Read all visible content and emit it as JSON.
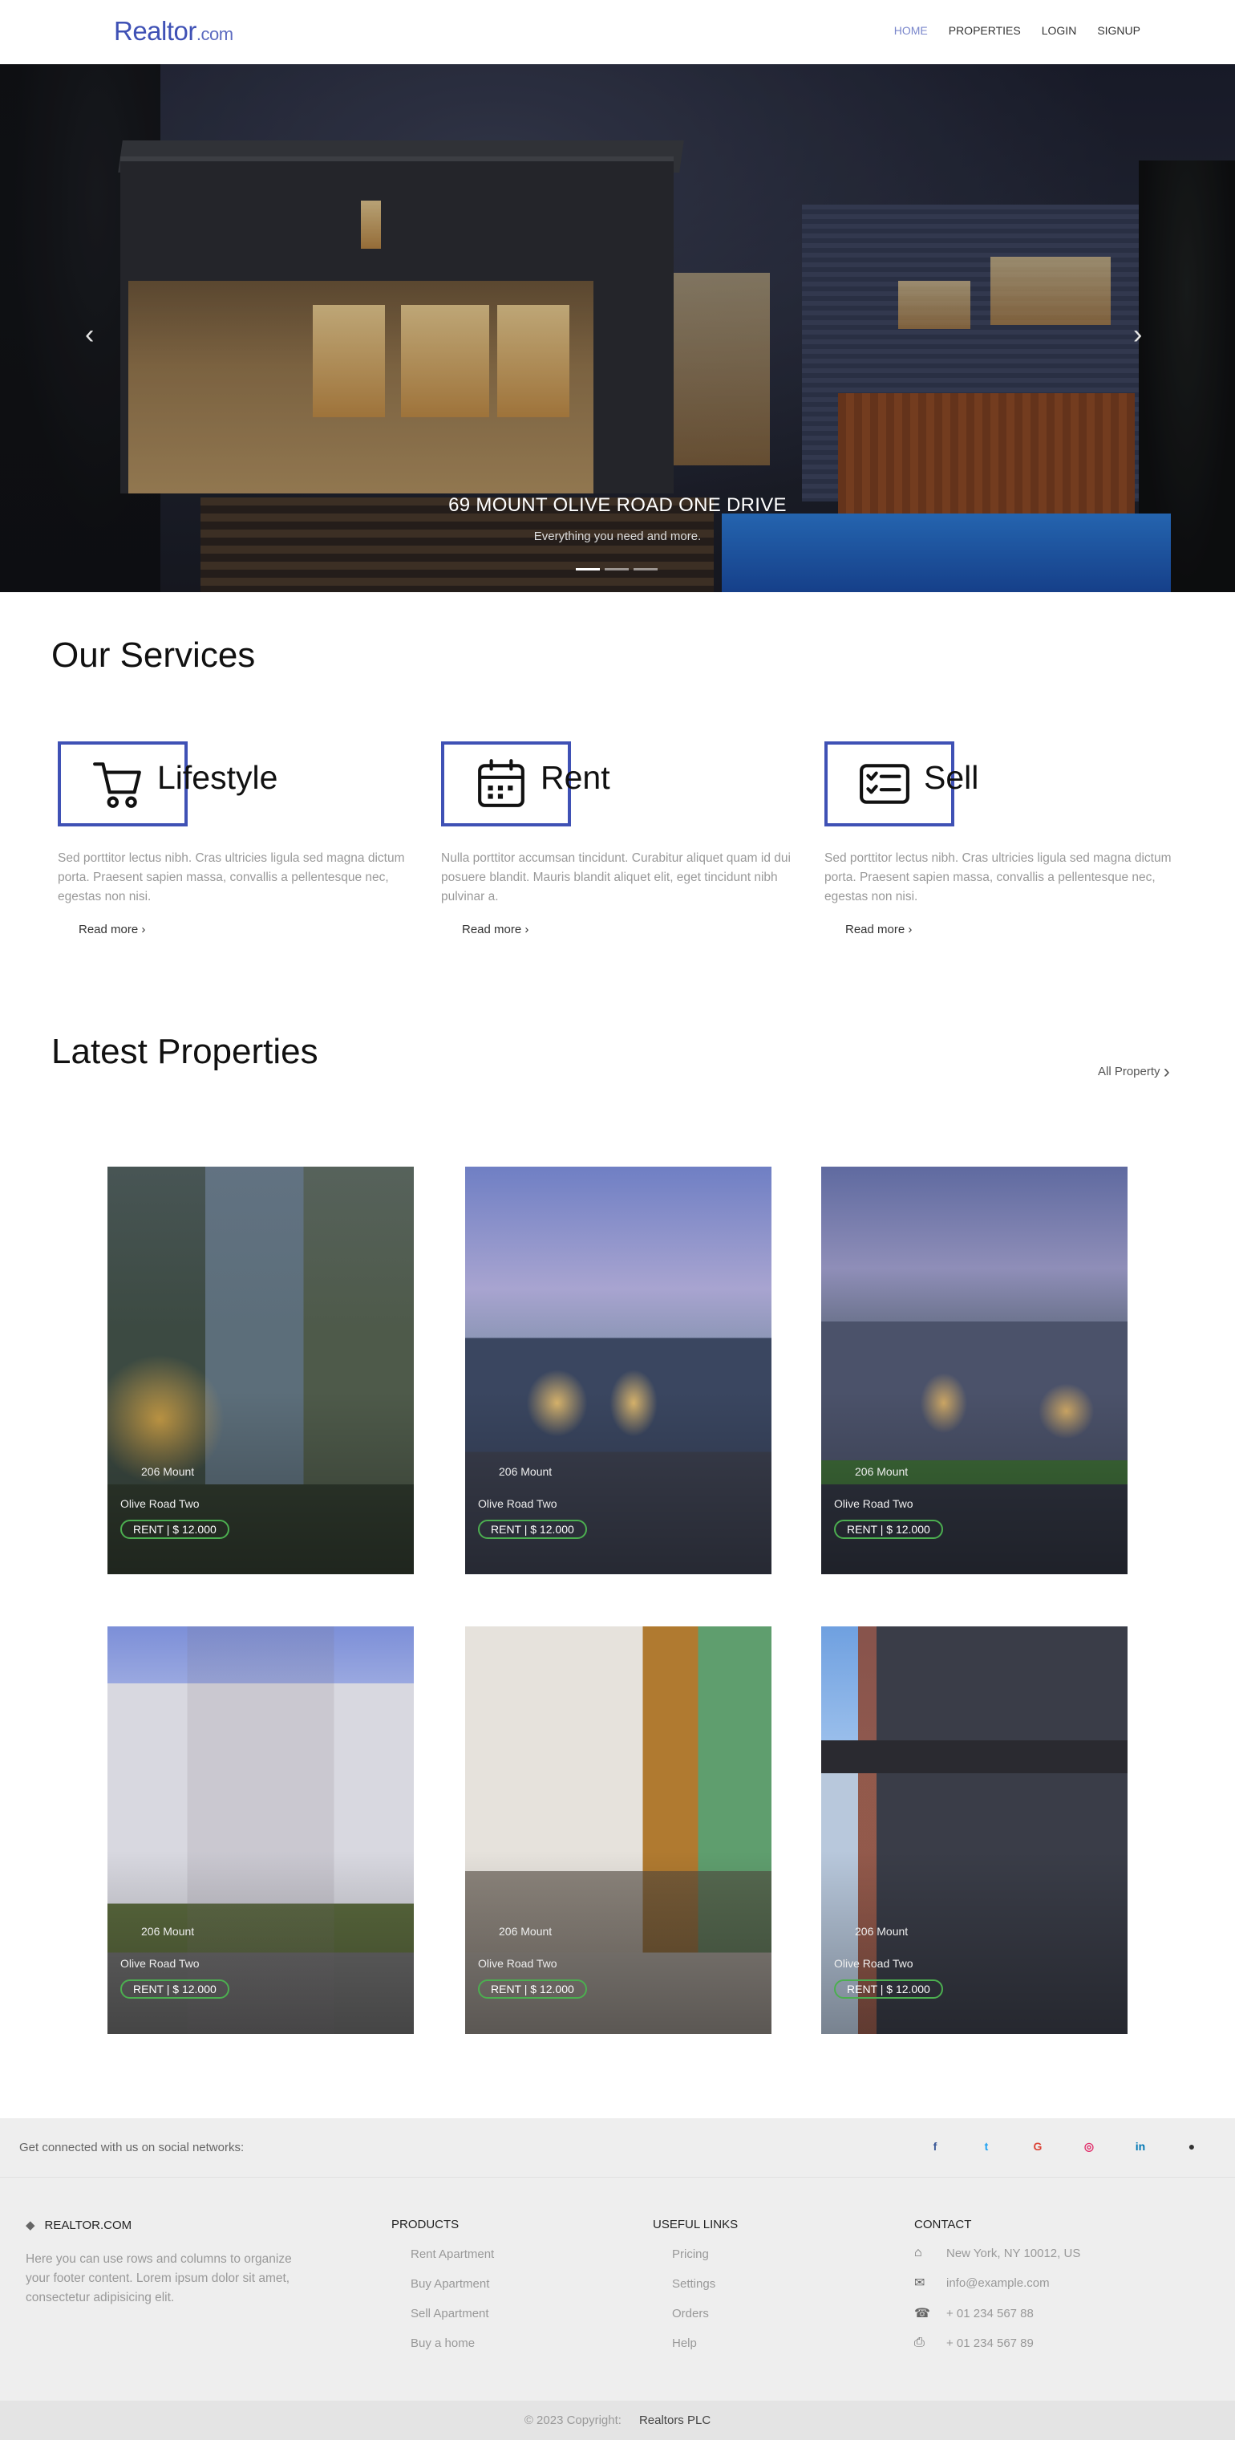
{
  "header": {
    "logo_main": "Realtor",
    "logo_tld": ".com",
    "nav": [
      "HOME",
      "PROPERTIES",
      "LOGIN",
      "SIGNUP"
    ]
  },
  "hero": {
    "title": "69 MOUNT OLIVE ROAD ONE DRIVE",
    "subtitle": "Everything you need and more.",
    "prev_icon": "chevron-left-icon",
    "next_icon": "chevron-right-icon",
    "slides": 3,
    "active_slide": 1
  },
  "services": {
    "title": "Our Services",
    "items": [
      {
        "name": "Lifestyle",
        "icon": "cart-icon",
        "desc": "Sed porttitor lectus nibh. Cras ultricies ligula sed magna dictum porta. Praesent sapien massa, convallis a pellentesque nec, egestas non nisi.",
        "more": "Read more"
      },
      {
        "name": "Rent",
        "icon": "calendar-icon",
        "desc": "Nulla porttitor accumsan tincidunt. Curabitur aliquet quam id dui posuere blandit. Mauris blandit aliquet elit, eget tincidunt nibh pulvinar a.",
        "more": "Read more"
      },
      {
        "name": "Sell",
        "icon": "checklist-icon",
        "desc": "Sed porttitor lectus nibh. Cras ultricies ligula sed magna dictum porta. Praesent sapien massa, convallis a pellentesque nec, egestas non nisi.",
        "more": "Read more"
      }
    ]
  },
  "properties": {
    "title": "Latest Properties",
    "all_link": "All Property",
    "items": [
      {
        "addr1": "206 Mount",
        "addr2": "Olive Road Two",
        "badge": "RENT | $ 12.000"
      },
      {
        "addr1": "206 Mount",
        "addr2": "Olive Road Two",
        "badge": "RENT | $ 12.000"
      },
      {
        "addr1": "206 Mount",
        "addr2": "Olive Road Two",
        "badge": "RENT | $ 12.000"
      },
      {
        "addr1": "206 Mount",
        "addr2": "Olive Road Two",
        "badge": "RENT | $ 12.000"
      },
      {
        "addr1": "206 Mount",
        "addr2": "Olive Road Two",
        "badge": "RENT | $ 12.000"
      },
      {
        "addr1": "206 Mount",
        "addr2": "Olive Road Two",
        "badge": "RENT | $ 12.000"
      }
    ]
  },
  "social": {
    "text": "Get connected with us on social networks:",
    "icons": [
      {
        "name": "facebook-icon",
        "glyph": "f",
        "color": "#3b5998"
      },
      {
        "name": "twitter-icon",
        "glyph": "t",
        "color": "#1da1f2"
      },
      {
        "name": "google-icon",
        "glyph": "G",
        "color": "#db4437"
      },
      {
        "name": "instagram-icon",
        "glyph": "◎",
        "color": "#e1306c"
      },
      {
        "name": "linkedin-icon",
        "glyph": "in",
        "color": "#0077b5"
      },
      {
        "name": "github-icon",
        "glyph": "●",
        "color": "#333333"
      }
    ]
  },
  "footer": {
    "brand": "REALTOR.COM",
    "about": "Here you can use rows and columns to organize your footer content. Lorem ipsum dolor sit amet, consectetur adipisicing elit.",
    "products_title": "PRODUCTS",
    "products": [
      "Rent Apartment",
      "Buy Apartment",
      "Sell Apartment",
      "Buy a home"
    ],
    "links_title": "USEFUL LINKS",
    "links": [
      "Pricing",
      "Settings",
      "Orders",
      "Help"
    ],
    "contact_title": "CONTACT",
    "contact": [
      {
        "icon": "home-icon",
        "text": "New York, NY 10012, US"
      },
      {
        "icon": "envelope-icon",
        "text": "info@example.com"
      },
      {
        "icon": "phone-icon",
        "text": "+ 01 234 567 88"
      },
      {
        "icon": "printer-icon",
        "text": "+ 01 234 567 89"
      }
    ]
  },
  "copyright": {
    "text": "© 2023 Copyright:",
    "brand": "Realtors PLC"
  },
  "colors": {
    "accent": "#3f51b5",
    "badge_border": "#4caf50"
  }
}
